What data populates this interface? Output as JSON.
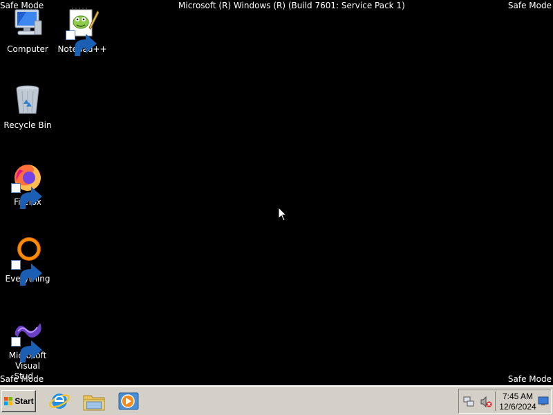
{
  "overlay": {
    "safe_mode_top_left": "Safe Mode",
    "safe_mode_top_right": "Safe Mode",
    "safe_mode_bottom_left": "Safe Mode",
    "safe_mode_bottom_right": "Safe Mode",
    "build_string": "Microsoft (R) Windows (R) (Build 7601: Service Pack 1)"
  },
  "desktop": {
    "icons": [
      {
        "label": "Computer",
        "icon": "computer-icon"
      },
      {
        "label": "Notepad++",
        "icon": "notepadpp-icon"
      },
      {
        "label": "Recycle Bin",
        "icon": "recycle-bin-icon"
      },
      {
        "label": "Firefox",
        "icon": "firefox-icon"
      },
      {
        "label": "Everything",
        "icon": "everything-icon"
      },
      {
        "label": "Microsoft Visual Stud...",
        "icon": "visual-studio-icon"
      }
    ]
  },
  "taskbar": {
    "start_label": "Start",
    "pinned": [
      "internet-explorer-icon",
      "file-explorer-icon",
      "media-player-icon"
    ],
    "clock": {
      "time": "7:45 AM",
      "date": "12/6/2024"
    }
  }
}
